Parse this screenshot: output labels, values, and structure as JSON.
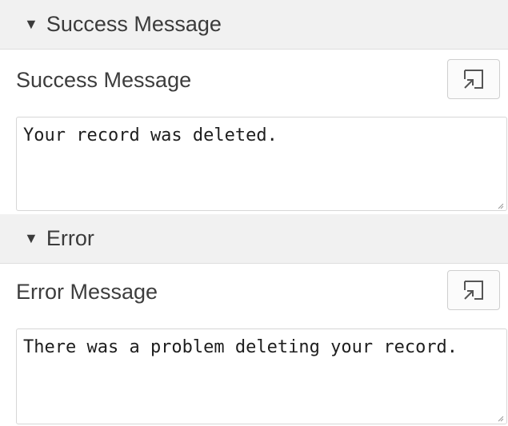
{
  "sections": {
    "success": {
      "header_label": "Success Message",
      "field_label": "Success Message",
      "value": "Your record was deleted.",
      "caret_icon": "caret-down-icon",
      "expand_icon": "open-in-expand-icon"
    },
    "error": {
      "header_label": "Error",
      "field_label": "Error Message",
      "value": "There was a problem deleting your record.",
      "caret_icon": "caret-down-icon",
      "expand_icon": "open-in-expand-icon"
    }
  },
  "colors": {
    "header_bg": "#f1f1f1",
    "text": "#3a3a3a",
    "border": "#d6d6d6"
  }
}
